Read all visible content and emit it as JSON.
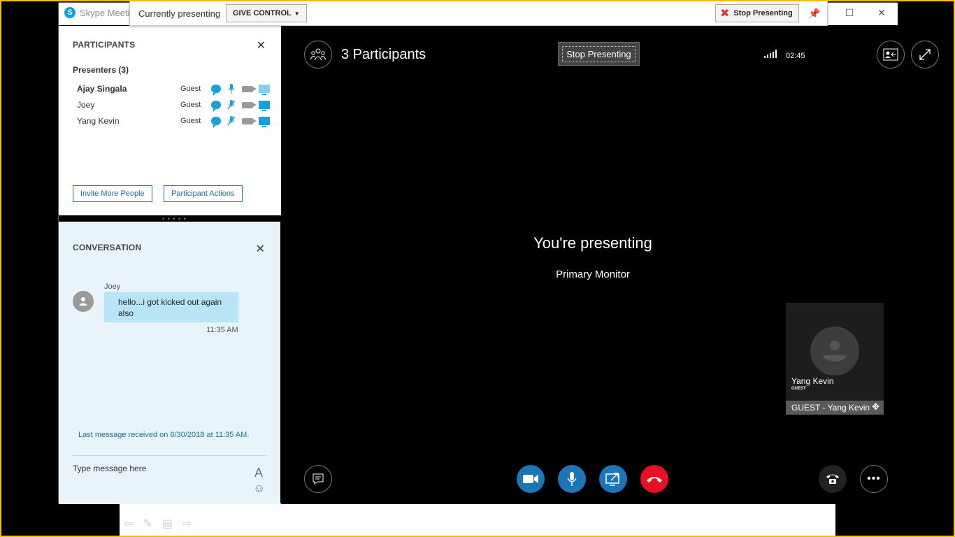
{
  "window": {
    "title": "Skype Meeting",
    "minimize_icon": "minimize",
    "maximize_icon": "maximize",
    "close_icon": "close"
  },
  "presenter_bar": {
    "status": "Currently presenting",
    "give_control": "GIVE CONTROL",
    "stop_presenting": "Stop Presenting"
  },
  "participants": {
    "title": "PARTICIPANTS",
    "presenters_heading": "Presenters (3)",
    "list": [
      {
        "name": "Ajay Singala",
        "role": "Guest",
        "muted": false,
        "bold": true
      },
      {
        "name": "Joey",
        "role": "Guest",
        "muted": true,
        "bold": false
      },
      {
        "name": "Yang Kevin",
        "role": "Guest",
        "muted": true,
        "bold": false
      }
    ],
    "invite_button": "Invite More People",
    "actions_button": "Participant Actions"
  },
  "conversation": {
    "title": "CONVERSATION",
    "message": {
      "sender": "Joey",
      "text": "hello...i got kicked out again also",
      "time": "11:35 AM"
    },
    "last_message": "Last message received on 6/30/2018 at 11:35 AM.",
    "input_placeholder": "Type message here",
    "font_label": "A"
  },
  "stage": {
    "participants_count": "3 Participants",
    "stop_presenting": "Stop Presenting",
    "call_time": "02:45",
    "presenting_title": "You're presenting",
    "monitor": "Primary Monitor",
    "tile": {
      "name": "Yang Kevin",
      "role": "GUEST",
      "caption": "GUEST - Yang Kevin"
    }
  },
  "colors": {
    "accent_blue": "#1b75b6",
    "hangup_red": "#e81123",
    "chat_bg": "#e8f3fa",
    "bubble": "#b8e4f7"
  }
}
